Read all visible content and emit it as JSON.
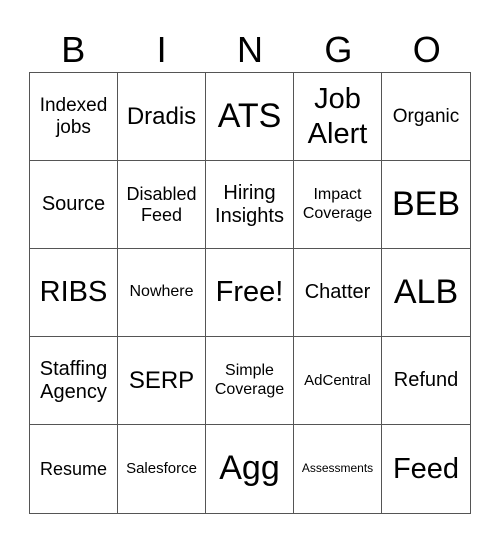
{
  "header": {
    "letters": [
      "B",
      "I",
      "N",
      "G",
      "O"
    ]
  },
  "grid": {
    "rows": [
      [
        "Indexed jobs",
        "Dradis",
        "ATS",
        "Job Alert",
        "Organic"
      ],
      [
        "Source",
        "Disabled Feed",
        "Hiring Insights",
        "Impact Coverage",
        "BEB"
      ],
      [
        "RIBS",
        "Nowhere",
        "Free!",
        "Chatter",
        "ALB"
      ],
      [
        "Staffing Agency",
        "SERP",
        "Simple Coverage",
        "AdCentral",
        "Refund"
      ],
      [
        "Resume",
        "Salesforce",
        "Agg",
        "Assessments",
        "Feed"
      ]
    ]
  }
}
